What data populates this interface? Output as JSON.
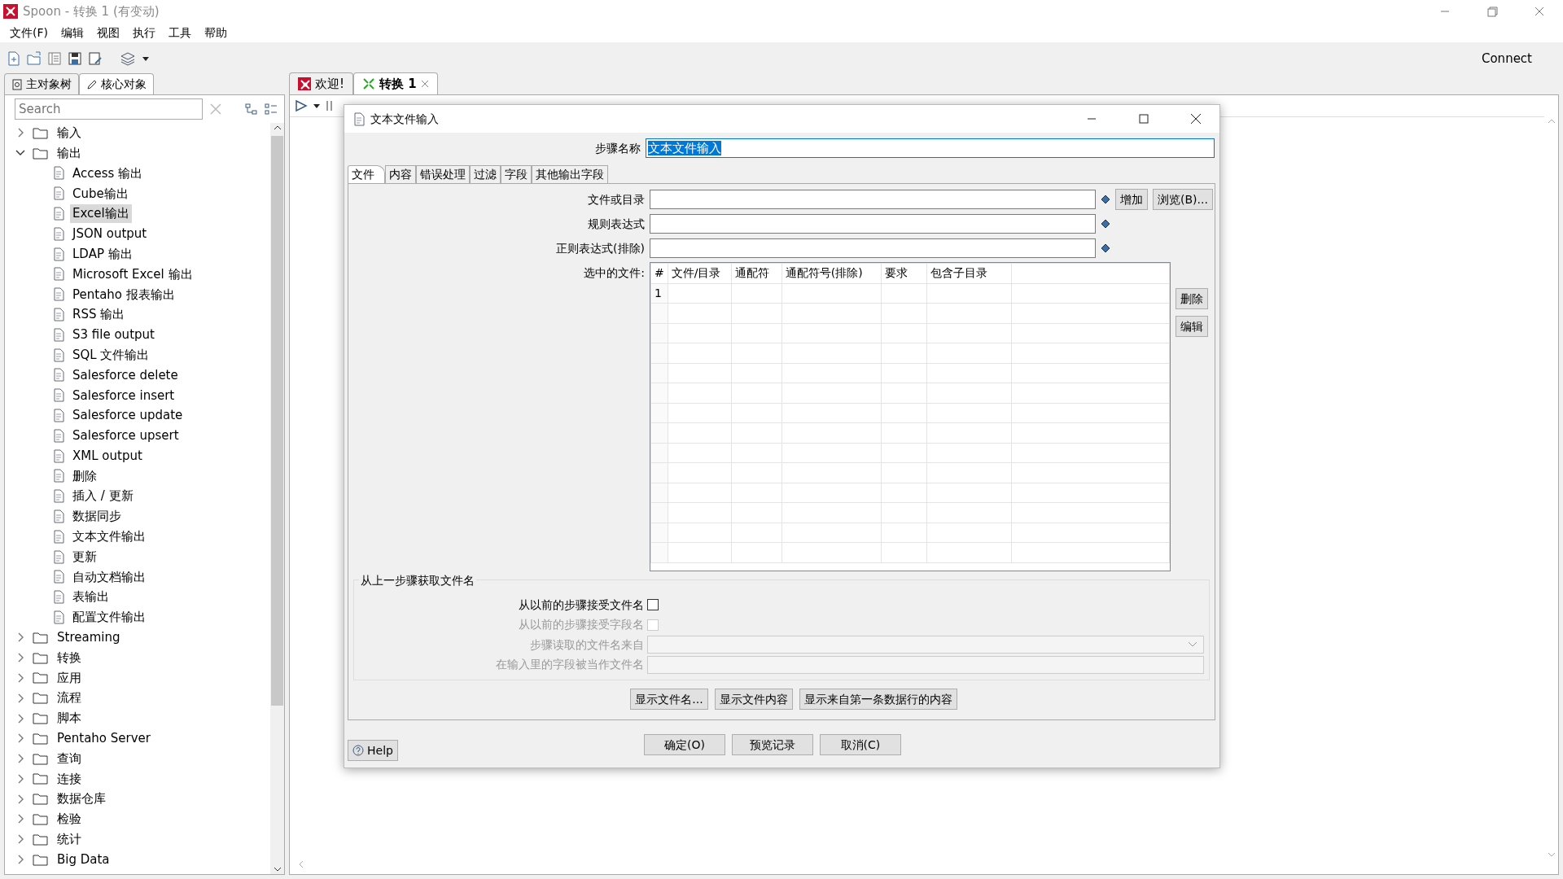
{
  "window": {
    "title": "Spoon - 转换 1 (有变动)"
  },
  "menu": [
    "文件(F)",
    "编辑",
    "视图",
    "执行",
    "工具",
    "帮助"
  ],
  "toolbar": {
    "connect": "Connect"
  },
  "left_panel": {
    "tabs": [
      {
        "label": "主对象树",
        "selected": false
      },
      {
        "label": "核心对象",
        "selected": true
      }
    ],
    "search": {
      "placeholder": "Search"
    },
    "tree": [
      {
        "label": "输入",
        "expanded": false,
        "selected": false
      },
      {
        "label": "输出",
        "expanded": true,
        "selected": false,
        "children": [
          {
            "label": "Access 输出",
            "selected": false
          },
          {
            "label": "Cube输出",
            "selected": false
          },
          {
            "label": "Excel输出",
            "selected": true
          },
          {
            "label": "JSON output",
            "selected": false
          },
          {
            "label": "LDAP 输出",
            "selected": false
          },
          {
            "label": "Microsoft Excel 输出",
            "selected": false
          },
          {
            "label": "Pentaho 报表输出",
            "selected": false
          },
          {
            "label": "RSS 输出",
            "selected": false
          },
          {
            "label": "S3 file output",
            "selected": false
          },
          {
            "label": "SQL 文件输出",
            "selected": false
          },
          {
            "label": "Salesforce delete",
            "selected": false
          },
          {
            "label": "Salesforce insert",
            "selected": false
          },
          {
            "label": "Salesforce update",
            "selected": false
          },
          {
            "label": "Salesforce upsert",
            "selected": false
          },
          {
            "label": "XML output",
            "selected": false
          },
          {
            "label": "删除",
            "selected": false
          },
          {
            "label": "插入 / 更新",
            "selected": false
          },
          {
            "label": "数据同步",
            "selected": false
          },
          {
            "label": "文本文件输出",
            "selected": false
          },
          {
            "label": "更新",
            "selected": false
          },
          {
            "label": "自动文档输出",
            "selected": false
          },
          {
            "label": "表输出",
            "selected": false
          },
          {
            "label": "配置文件输出",
            "selected": false
          }
        ]
      },
      {
        "label": "Streaming",
        "expanded": false,
        "selected": false
      },
      {
        "label": "转换",
        "expanded": false,
        "selected": false
      },
      {
        "label": "应用",
        "expanded": false,
        "selected": false
      },
      {
        "label": "流程",
        "expanded": false,
        "selected": false
      },
      {
        "label": "脚本",
        "expanded": false,
        "selected": false
      },
      {
        "label": "Pentaho Server",
        "expanded": false,
        "selected": false
      },
      {
        "label": "查询",
        "expanded": false,
        "selected": false
      },
      {
        "label": "连接",
        "expanded": false,
        "selected": false
      },
      {
        "label": "数据仓库",
        "expanded": false,
        "selected": false
      },
      {
        "label": "检验",
        "expanded": false,
        "selected": false
      },
      {
        "label": "统计",
        "expanded": false,
        "selected": false
      },
      {
        "label": "Big Data",
        "expanded": false,
        "selected": false
      }
    ]
  },
  "editor_tabs": [
    {
      "label": "欢迎!",
      "selected": false,
      "closable": false
    },
    {
      "label": "转换 1",
      "selected": true,
      "closable": true
    }
  ],
  "dialog": {
    "title": "文本文件输入",
    "step_name_label": "步骤名称",
    "step_name": "文本文件输入",
    "step_name_highlighted": true,
    "tabs": [
      {
        "label": "文件",
        "selected": true
      },
      {
        "label": "内容",
        "selected": false
      },
      {
        "label": "错误处理",
        "selected": false
      },
      {
        "label": "过滤",
        "selected": false
      },
      {
        "label": "字段",
        "selected": false
      },
      {
        "label": "其他输出字段",
        "selected": false
      }
    ],
    "fields": [
      {
        "label": "文件或目录"
      },
      {
        "label": "规则表达式"
      },
      {
        "label": "正则表达式(排除)"
      }
    ],
    "add_button": "增加",
    "browse_button": "浏览(B)...",
    "selected_files_label": "选中的文件:",
    "table": {
      "columns": [
        "#",
        "文件/目录",
        "通配符",
        "通配符号(排除)",
        "要求",
        "包含子目录"
      ],
      "rows": [
        [
          "1"
        ]
      ]
    },
    "side_buttons": [
      "删除",
      "编辑"
    ],
    "group": {
      "title": "从上一步骤获取文件名",
      "rows": [
        {
          "kind": "checkbox",
          "label": "从以前的步骤接受文件名",
          "checked": false,
          "disabled": false
        },
        {
          "kind": "checkbox",
          "label": "从以前的步骤接受字段名",
          "checked": false,
          "disabled": true
        },
        {
          "kind": "select",
          "label": "步骤读取的文件名来自",
          "disabled": true
        },
        {
          "kind": "text",
          "label": "在输入里的字段被当作文件名",
          "disabled": true
        }
      ]
    },
    "show_buttons": [
      "显示文件名...",
      "显示文件内容",
      "显示来自第一条数据行的内容"
    ],
    "footer_buttons": [
      "确定(O)",
      "预览记录",
      "取消(C)"
    ],
    "help": "Help"
  }
}
